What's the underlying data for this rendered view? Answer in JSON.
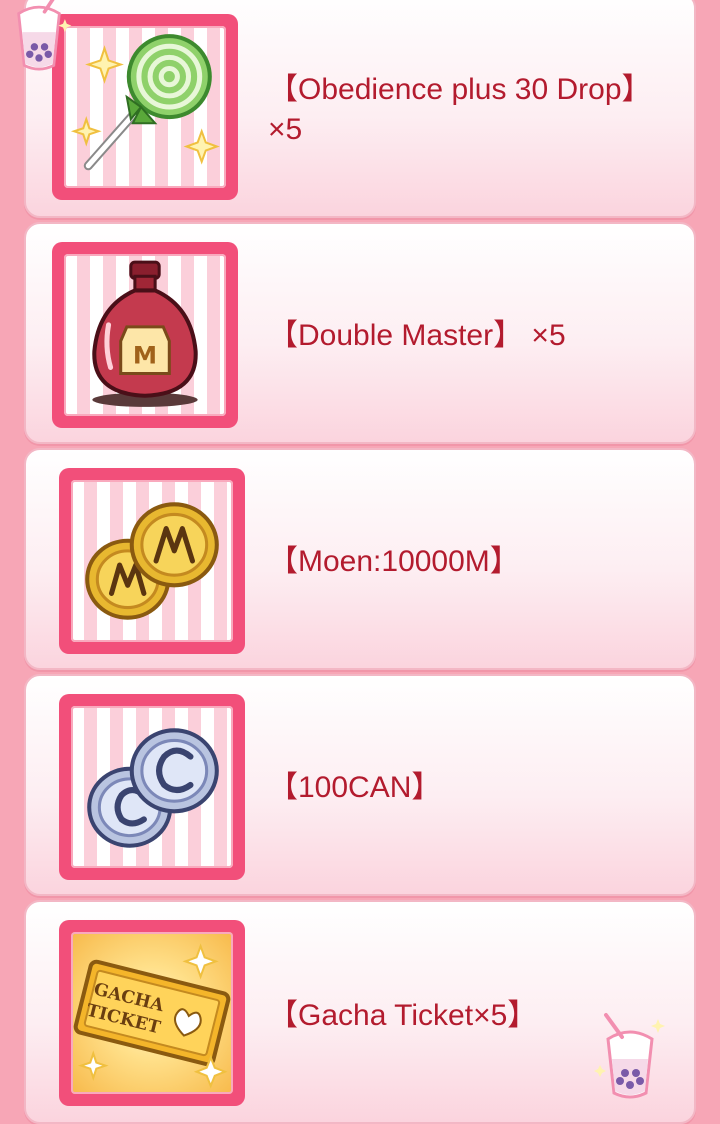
{
  "items": [
    {
      "label": "【Obedience plus 30 Drop】×5",
      "icon": "lollipop-icon"
    },
    {
      "label": "【Double Master】 ×5",
      "icon": "potion-bottle-icon"
    },
    {
      "label": "【Moen:10000M】",
      "icon": "gold-coins-icon"
    },
    {
      "label": "【100CAN】",
      "icon": "silver-coins-icon"
    },
    {
      "label": "【Gacha Ticket×5】",
      "icon": "gacha-ticket-icon",
      "icon_text": "GACHA TICKET"
    }
  ],
  "colors": {
    "background": "#f7a6b6",
    "frame": "#f24f7a",
    "label_text": "#b31b2e"
  },
  "decorations": [
    "bubble-tea-icon",
    "bubble-tea-icon"
  ]
}
